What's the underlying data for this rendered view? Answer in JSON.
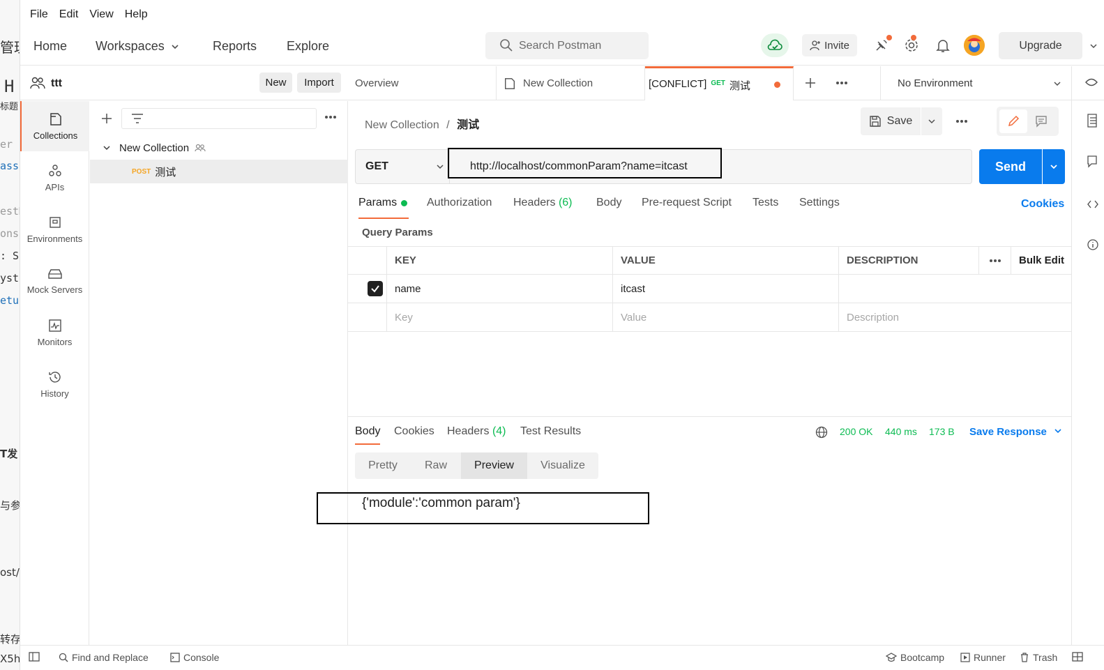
{
  "menu": [
    "File",
    "Edit",
    "View",
    "Help"
  ],
  "nav": {
    "home": "Home",
    "workspaces": "Workspaces",
    "reports": "Reports",
    "explore": "Explore"
  },
  "search": {
    "placeholder": "Search Postman"
  },
  "header": {
    "invite": "Invite",
    "upgrade": "Upgrade"
  },
  "workspace": {
    "name": "ttt",
    "new_label": "New",
    "import_label": "Import"
  },
  "rail": [
    "Collections",
    "APIs",
    "Environments",
    "Mock Servers",
    "Monitors",
    "History"
  ],
  "tree": {
    "collection": "New Collection",
    "request_method": "POST",
    "request_name": "测试"
  },
  "tabs": {
    "overview": "Overview",
    "collection": "New Collection",
    "active_prefix": "[CONFLICT]",
    "active_method": "GET",
    "active_name": "测试"
  },
  "environment": "No Environment",
  "breadcrumb": {
    "parent": "New Collection",
    "sep": "/",
    "current": "测试"
  },
  "toolbar": {
    "save": "Save"
  },
  "request": {
    "method": "GET",
    "url": "http://localhost/commonParam?name=itcast",
    "send": "Send"
  },
  "req_tabs": {
    "params": "Params",
    "authorization": "Authorization",
    "headers": "Headers",
    "headers_count": "(6)",
    "body": "Body",
    "prerequest": "Pre-request Script",
    "tests": "Tests",
    "settings": "Settings",
    "cookies": "Cookies"
  },
  "query_params": {
    "title": "Query Params",
    "headers": {
      "key": "KEY",
      "value": "VALUE",
      "description": "DESCRIPTION",
      "bulk_edit": "Bulk Edit"
    },
    "rows": [
      {
        "key": "name",
        "value": "itcast",
        "description": ""
      }
    ],
    "placeholders": {
      "key": "Key",
      "value": "Value",
      "description": "Description"
    }
  },
  "response": {
    "tabs": {
      "body": "Body",
      "cookies": "Cookies",
      "headers": "Headers",
      "headers_count": "(4)",
      "test_results": "Test Results"
    },
    "status": "200 OK",
    "time": "440 ms",
    "size": "173 B",
    "save_response": "Save Response",
    "views": [
      "Pretty",
      "Raw",
      "Preview",
      "Visualize"
    ],
    "active_view": "Preview",
    "body": "{'module':'common param'}"
  },
  "statusbar": {
    "find_replace": "Find and Replace",
    "console": "Console",
    "bootcamp": "Bootcamp",
    "runner": "Runner",
    "trash": "Trash"
  },
  "background_window": [
    "管理",
    "H",
    "标题",
    "er",
    "ass",
    "estM",
    "onse",
    ": St",
    "yste",
    "etur",
    "T发",
    "与参",
    "ost/c",
    "转存",
    "X5h"
  ],
  "colors": {
    "accent": "#f26b3a",
    "primary": "#097bed",
    "success": "#0cbb52",
    "post": "#f5a524"
  }
}
